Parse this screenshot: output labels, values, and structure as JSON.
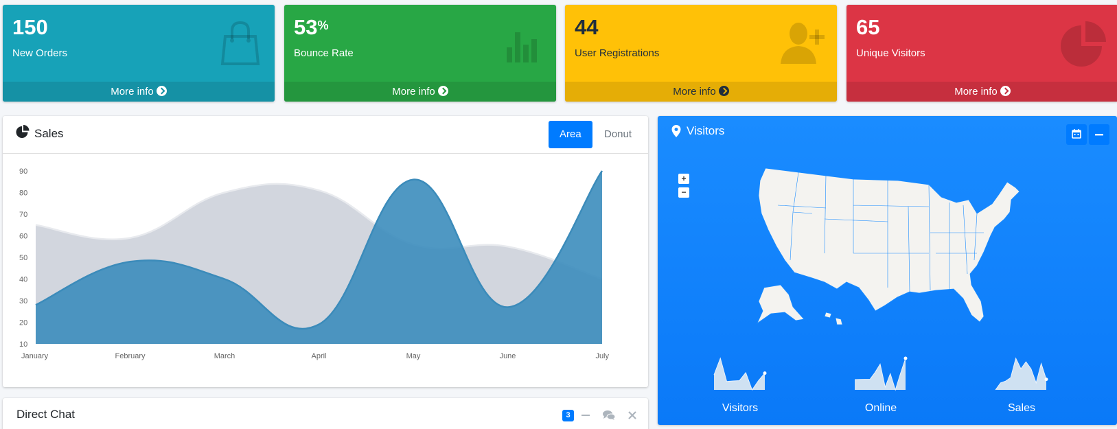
{
  "stat_boxes": [
    {
      "value": "150",
      "sup": "",
      "label": "New Orders",
      "icon": "shopping-bag-icon",
      "footer": "More info"
    },
    {
      "value": "53",
      "sup": "%",
      "label": "Bounce Rate",
      "icon": "bar-chart-icon",
      "footer": "More info"
    },
    {
      "value": "44",
      "sup": "",
      "label": "User Registrations",
      "icon": "user-plus-icon",
      "footer": "More info"
    },
    {
      "value": "65",
      "sup": "",
      "label": "Unique Visitors",
      "icon": "pie-chart-icon",
      "footer": "More info"
    }
  ],
  "colors": {
    "info": "#17a2b8",
    "success": "#28a745",
    "warning": "#ffc107",
    "danger": "#dc3545",
    "primary": "#007bff"
  },
  "sales": {
    "title": "Sales",
    "tabs": [
      "Area",
      "Donut"
    ],
    "active_tab": "Area"
  },
  "chart_data": {
    "type": "area",
    "categories": [
      "January",
      "February",
      "March",
      "April",
      "May",
      "June",
      "July"
    ],
    "series": [
      {
        "values": [
          65,
          59,
          80,
          81,
          56,
          55,
          40
        ],
        "color": "#d2d6de"
      },
      {
        "values": [
          28,
          48,
          40,
          19,
          86,
          27,
          90
        ],
        "color": "#3c8dbc"
      }
    ],
    "yticks": [
      10,
      20,
      30,
      40,
      50,
      60,
      70,
      80,
      90
    ],
    "ylim": [
      10,
      90
    ],
    "grid": false
  },
  "chat": {
    "title": "Direct Chat",
    "badge": "3"
  },
  "visitors": {
    "title": "Visitors",
    "zoom_in": "+",
    "zoom_out": "−",
    "sparklines": [
      {
        "label": "Visitors",
        "values": [
          1000,
          1200,
          920,
          927,
          931,
          1027,
          819,
          930,
          1021
        ]
      },
      {
        "label": "Online",
        "values": [
          515,
          519,
          520,
          522,
          652,
          810,
          370,
          627,
          319,
          630,
          921
        ]
      },
      {
        "label": "Sales",
        "values": [
          15,
          19,
          20,
          22,
          33,
          27,
          31,
          27,
          19,
          30,
          21
        ]
      }
    ]
  }
}
